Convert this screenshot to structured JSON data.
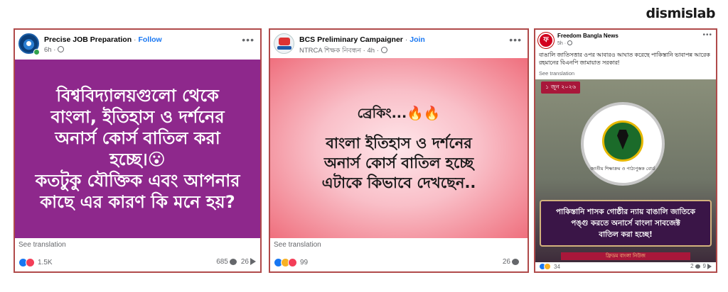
{
  "brand": "dismislab",
  "posts": [
    {
      "page_name": "Precise JOB Preparation",
      "separator": " · ",
      "action": "Follow",
      "time": "6h",
      "sep2": " · ",
      "main_text": [
        "বিশ্ববিদ্যালয়গুলো থেকে",
        "বাংলা, ইতিহাস ও দর্শনের",
        "অনার্স কোর্স বাতিল করা",
        "হচ্ছে।😮",
        "কতটুকু যৌক্তিক এবং আপনার",
        "কাছে এর কারণ কি মনে হয়?"
      ],
      "see_translation": "See translation",
      "reaction_count": "1.5K",
      "comments": "685",
      "shares": "26",
      "panel_color": "#8e288c"
    },
    {
      "page_name": "BCS Preliminary Campaigner",
      "separator": " · ",
      "action": "Join",
      "subtitle": "NTRCA শিক্ষক নিবন্ধন",
      "time": "4h",
      "sep2": " · ",
      "breaking": "ব্রেকিং...🔥🔥",
      "main_text": [
        "বাংলা ইতিহাস ও দর্শনের",
        "অনার্স কোর্স বাতিল হচ্ছে",
        "এটাকে কিভাবে দেখছেন.."
      ],
      "see_translation": "See translation",
      "reaction_count": "99",
      "comments": "26"
    },
    {
      "page_name": "Freedom Bangla News",
      "time": "5h",
      "sep2": " · ",
      "body": "বাঙালি জাতিসত্তার ওপর আবারও আঘাত করেছে পাকিস্তানি ভাবাপন্ন আরেক রহমানের বিএনপি জামায়াত সরকার!",
      "see_translation": "See translation",
      "date_badge": "১ জুন ২০২৬",
      "seal_text": "জাতীয় শিক্ষাক্রম ও পাঠ্যপুস্তক বোর্ড",
      "banner": [
        "পাকিস্তানি শাসক গোষ্ঠীর ন্যায় বাঙালি জাতিকে",
        "পঙ্গু করতে অনার্সে বাংলা সাবজেক্ট",
        "বাতিল করা হচ্ছে!"
      ],
      "source": "ফ্রিডম বাংলা নিউজ",
      "reaction_count": "34",
      "comments": "2",
      "shares": "9"
    }
  ],
  "icons": [
    "globe-icon",
    "more-options-icon",
    "like-reaction-icon",
    "love-reaction-icon",
    "haha-reaction-icon",
    "comment-icon",
    "share-icon"
  ]
}
